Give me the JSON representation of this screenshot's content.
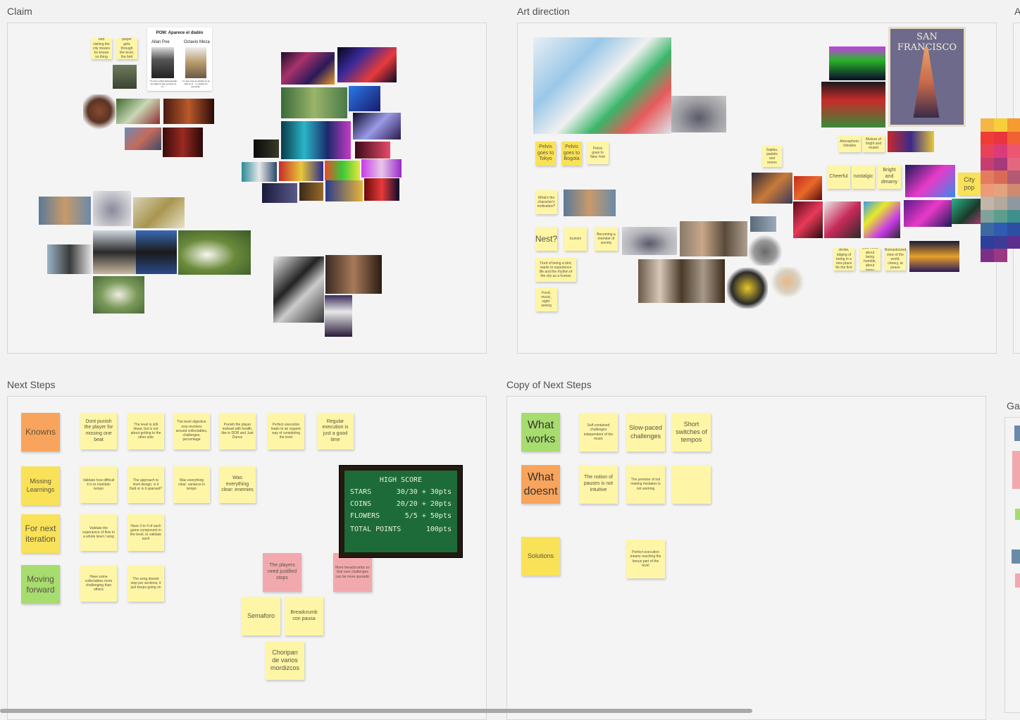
{
  "frames": {
    "claim": "Claim",
    "art_direction": "Art direction",
    "next_steps": "Next Steps",
    "copy_next_steps": "Copy of Next Steps",
    "cut_a": "A",
    "cut_ga": "Ga"
  },
  "claim": {
    "notes": [
      "Being a bird visiting the city means he knows so thing happened",
      "As the player gets through the level, the bird is..."
    ],
    "doc": {
      "title": "POM: Aparece el diablo",
      "left_name": "Allan Poe",
      "right_name": "Octavio Meza",
      "left_caption": "\"Yo vivo a gritar desesperado, sin saber lo que es llorar ya el...\"",
      "right_caption": "\"Lo que mas se quiebra en la vida es el... no quedo sin escuchar\""
    }
  },
  "art": {
    "notes": {
      "tokyo": "Pelvis goes to Tokyo",
      "bogota": "Pelvis goes to Bogota",
      "newyork": "Pelvis goes to New York",
      "motivation": "What's the character's motivation?",
      "nest": "Nest?",
      "tourism": "tourism",
      "member": "Becoming a member of society",
      "tired": "Tired of being a bird, wants to experience life and the rhythm of the city as a human",
      "food": "Food, music, sight-seeing",
      "saplas": "Saplas, pastels and neons",
      "cheerful": "Cheerful",
      "nostalgic": "nostalgic",
      "bright": "Bright and dreamy",
      "citypop": "City pop",
      "atmosphere": "Atmospheric climates",
      "mixture": "Mixture of bright and muted",
      "stroke": "The stroke, edging of being in a new place for the first time",
      "brighten": "Brighten your mind about being humble, about being fearless",
      "romanticized": "Romanticized view of the world, cheery, at peace"
    },
    "poster_title": "SAN FRANCISCO",
    "palette": [
      "#f6b645",
      "#f7ce3c",
      "#f59b2f",
      "#ef3c34",
      "#e9363d",
      "#f26133",
      "#e8425a",
      "#dc3b7a",
      "#ee5573",
      "#c63e6f",
      "#a7387a",
      "#e46780",
      "#e57c5f",
      "#d96b56",
      "#b45a71",
      "#ee9a79",
      "#e3a37f",
      "#cf8a6f",
      "#c2b6a8",
      "#b3a99d",
      "#8f98a0",
      "#7fa29b",
      "#5c9e8c",
      "#3f8f8c",
      "#3c6aa0",
      "#2e5cb3",
      "#2b4fa3",
      "#2c3f9b",
      "#3e3a97",
      "#5c2f8f",
      "#7c2f86",
      "#9a3883"
    ]
  },
  "next_steps": {
    "row_knowns": "Knowns",
    "row_missing": "Missing Learnings",
    "row_next": "For next iteration",
    "row_moving": "Moving forward",
    "k1": "Dont punish the player for missing one beat",
    "k2": "The level is still linear, but is not about getting to the other side",
    "k3": "The level objective now revolves around collectables, challenges, percentage",
    "k4": "Punish the player instead with health, like in DDR and Just Dance",
    "k5": "Perfect execution leads to an organic way of completing the level",
    "k6": "Regular execution is just a good time",
    "m1": "Validate how difficult it is to maintain tempo",
    "m2": "The approach to level design, is it fluid or is it sparsed?",
    "m3": "Was everything clear: variance in tempo",
    "m4": "Was everything clear: enemies",
    "n1": "Validate the experience of flow in a whole level / song",
    "n2": "Have 3 to 4 of each game component in the level, to validate each",
    "v1": "Have some collectables more challenging than others",
    "v2": "The song doesnt stop per sections, it just keeps going on",
    "pink1": "The players need justified stops",
    "pink2": "More breadcrumbs so that over challenges can be more sporadic",
    "semaforo": "Semaforo",
    "breadcrumb": "Breadcrumb con pausa",
    "choripan": "Choripan de varios mordizcos",
    "scoreboard": {
      "title": "HIGH SCORE",
      "rows": [
        {
          "label": "STARS",
          "value": "30/30 + 30pts"
        },
        {
          "label": "COINS",
          "value": "20/20 + 20pts"
        },
        {
          "label": "FLOWERS",
          "value": "5/5 + 50pts"
        }
      ],
      "total_label": "TOTAL POINTS",
      "total_value": "100pts"
    }
  },
  "copy_next": {
    "works": "What works",
    "doesnt": "What doesnt",
    "solutions": "Solutions",
    "w1": "Self contained challenges independent of the music",
    "w2": "Slow-paced challenges",
    "w3": "Short switches of tempos",
    "d1": "The notion of pauses is not intuitive",
    "d2": "The premise of not making mistakes is not working",
    "s1": "Perfect execution means reaching the bonus part of the level"
  }
}
